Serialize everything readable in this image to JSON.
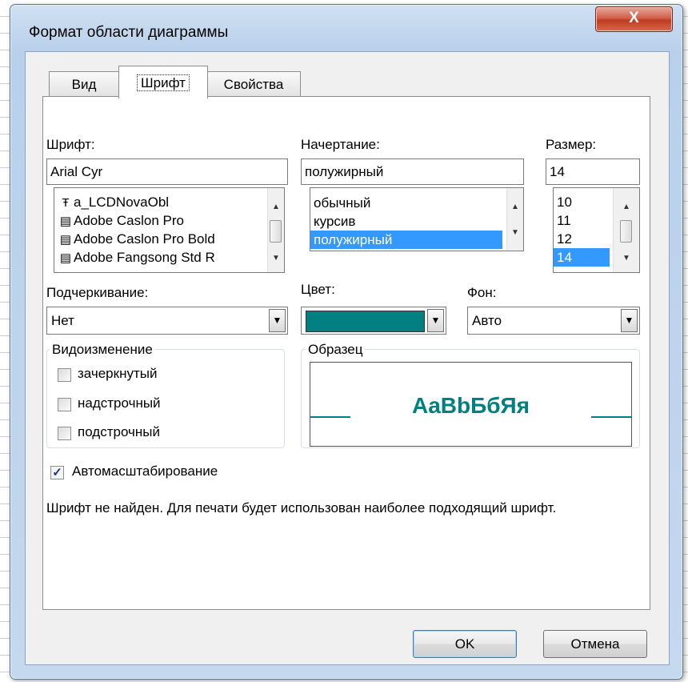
{
  "window": {
    "title": "Формат области диаграммы",
    "close_glyph": "X"
  },
  "tabs": [
    {
      "label": "Вид",
      "active": false
    },
    {
      "label": "Шрифт",
      "active": true
    },
    {
      "label": "Свойства",
      "active": false
    }
  ],
  "font": {
    "label": "Шрифт:",
    "value": "Arial Cyr",
    "list": [
      {
        "icon": "truetype-font-icon",
        "glyph": "Ŧ",
        "name": "a_LCDNovaObl"
      },
      {
        "icon": "printer-font-icon",
        "glyph": "▤",
        "name": "Adobe Caslon Pro"
      },
      {
        "icon": "printer-font-icon",
        "glyph": "▤",
        "name": "Adobe Caslon Pro Bold"
      },
      {
        "icon": "printer-font-icon",
        "glyph": "▤",
        "name": "Adobe Fangsong Std R"
      }
    ]
  },
  "style": {
    "label": "Начертание:",
    "value": "полужирный",
    "list": [
      "обычный",
      "курсив",
      "полужирный"
    ],
    "selected_index": 2
  },
  "size": {
    "label": "Размер:",
    "value": "14",
    "list": [
      "10",
      "11",
      "12",
      "14"
    ],
    "selected_index": 3
  },
  "underline": {
    "label": "Подчеркивание:",
    "value": "Нет"
  },
  "color": {
    "label": "Цвет:",
    "swatch": "#008080"
  },
  "background": {
    "label": "Фон:",
    "value": "Авто"
  },
  "effects": {
    "label": "Видоизменение",
    "items": [
      {
        "label": "зачеркнутый",
        "checked": false
      },
      {
        "label": "надстрочный",
        "checked": false
      },
      {
        "label": "подстрочный",
        "checked": false
      }
    ]
  },
  "preview": {
    "label": "Образец",
    "sample": "AaBbБбЯя",
    "color": "#008080"
  },
  "autoscale": {
    "label": "Автомасштабирование",
    "checked": true,
    "check_glyph": "✓"
  },
  "message": "Шрифт не найден. Для печати будет использован наиболее подходящий шрифт.",
  "buttons": {
    "ok": "OK",
    "cancel": "Отмена"
  }
}
